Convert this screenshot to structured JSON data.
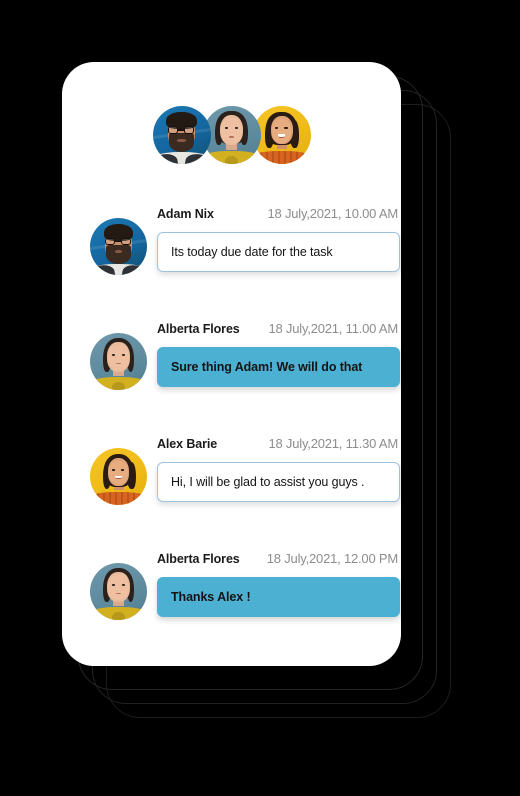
{
  "theme": {
    "page_background": "#000000",
    "card_background": "#ffffff",
    "incoming_bubble_color": "#4cb0d2",
    "outgoing_bubble_border": "#9dc2e0",
    "name_text_color": "#1b1b1b",
    "time_text_color": "#8d8d8d",
    "avatar_adam_bg": "#1466a0",
    "avatar_alberta_bg": "#5e8a9e",
    "avatar_alex_bg": "#efbb18"
  },
  "header": {
    "participants": [
      {
        "name": "Adam Nix",
        "avatar": "avatar-adam",
        "bg_color": "#1466a0"
      },
      {
        "name": "Alberta Flores",
        "avatar": "avatar-alberta",
        "bg_color": "#5e8a9e"
      },
      {
        "name": "Alex Barie",
        "avatar": "avatar-alex",
        "bg_color": "#efbb18"
      }
    ]
  },
  "conversation": {
    "messages": [
      {
        "sender": "Adam Nix",
        "timestamp": "18 July,2021, 10.00 AM",
        "text": "Its today due date for the task",
        "avatar": "avatar-adam",
        "style": "outgoing"
      },
      {
        "sender": "Alberta Flores",
        "timestamp": "18 July,2021, 11.00 AM",
        "text": "Sure thing Adam! We will do that",
        "avatar": "avatar-alberta",
        "style": "incoming"
      },
      {
        "sender": "Alex Barie",
        "timestamp": "18 July,2021, 11.30 AM",
        "text": "Hi, I will be glad to assist you guys .",
        "avatar": "avatar-alex",
        "style": "outgoing"
      },
      {
        "sender": "Alberta Flores",
        "timestamp": "18 July,2021, 12.00 PM",
        "text": "Thanks Alex !",
        "avatar": "avatar-alberta",
        "style": "incoming"
      }
    ]
  }
}
